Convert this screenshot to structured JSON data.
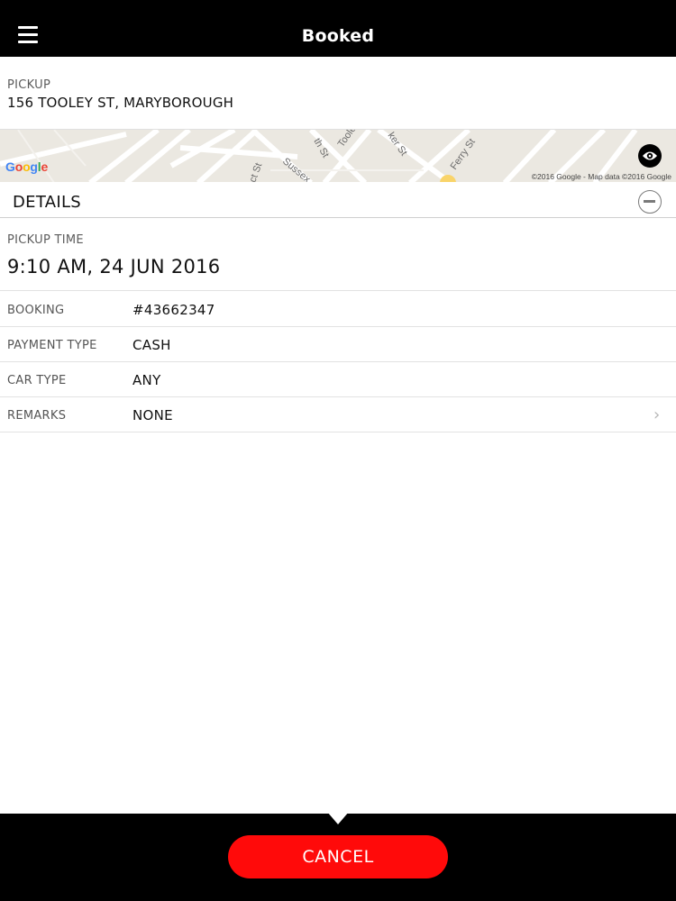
{
  "header": {
    "title": "Booked",
    "menu_icon": "hamburger-menu-icon"
  },
  "pickup": {
    "label": "PICKUP",
    "address": "156 TOOLEY ST, MARYBOROUGH"
  },
  "map": {
    "logo": {
      "g1": "G",
      "o1": "o",
      "o2": "o",
      "g2": "g",
      "l": "l",
      "e": "e"
    },
    "attribution": "©2016 Google - Map data ©2016 Google",
    "street_labels": [
      "th St",
      "Tooley",
      "ker St",
      "Ferry St",
      "Sussex",
      "ct St"
    ],
    "eye_icon": "eye-icon"
  },
  "details": {
    "title": "DETAILS",
    "collapse_icon": "minus-circle-icon",
    "pickup_time_label": "PICKUP TIME",
    "pickup_time_value": "9:10 AM, 24 JUN 2016",
    "rows": [
      {
        "label": "BOOKING",
        "value": "#43662347"
      },
      {
        "label": "PAYMENT TYPE",
        "value": "CASH"
      },
      {
        "label": "CAR TYPE",
        "value": "ANY"
      },
      {
        "label": "REMARKS",
        "value": "NONE",
        "chevron": "›"
      }
    ]
  },
  "footer": {
    "cancel_label": "CANCEL"
  },
  "colors": {
    "accent": "#ff0a0a",
    "bar": "#000000"
  }
}
